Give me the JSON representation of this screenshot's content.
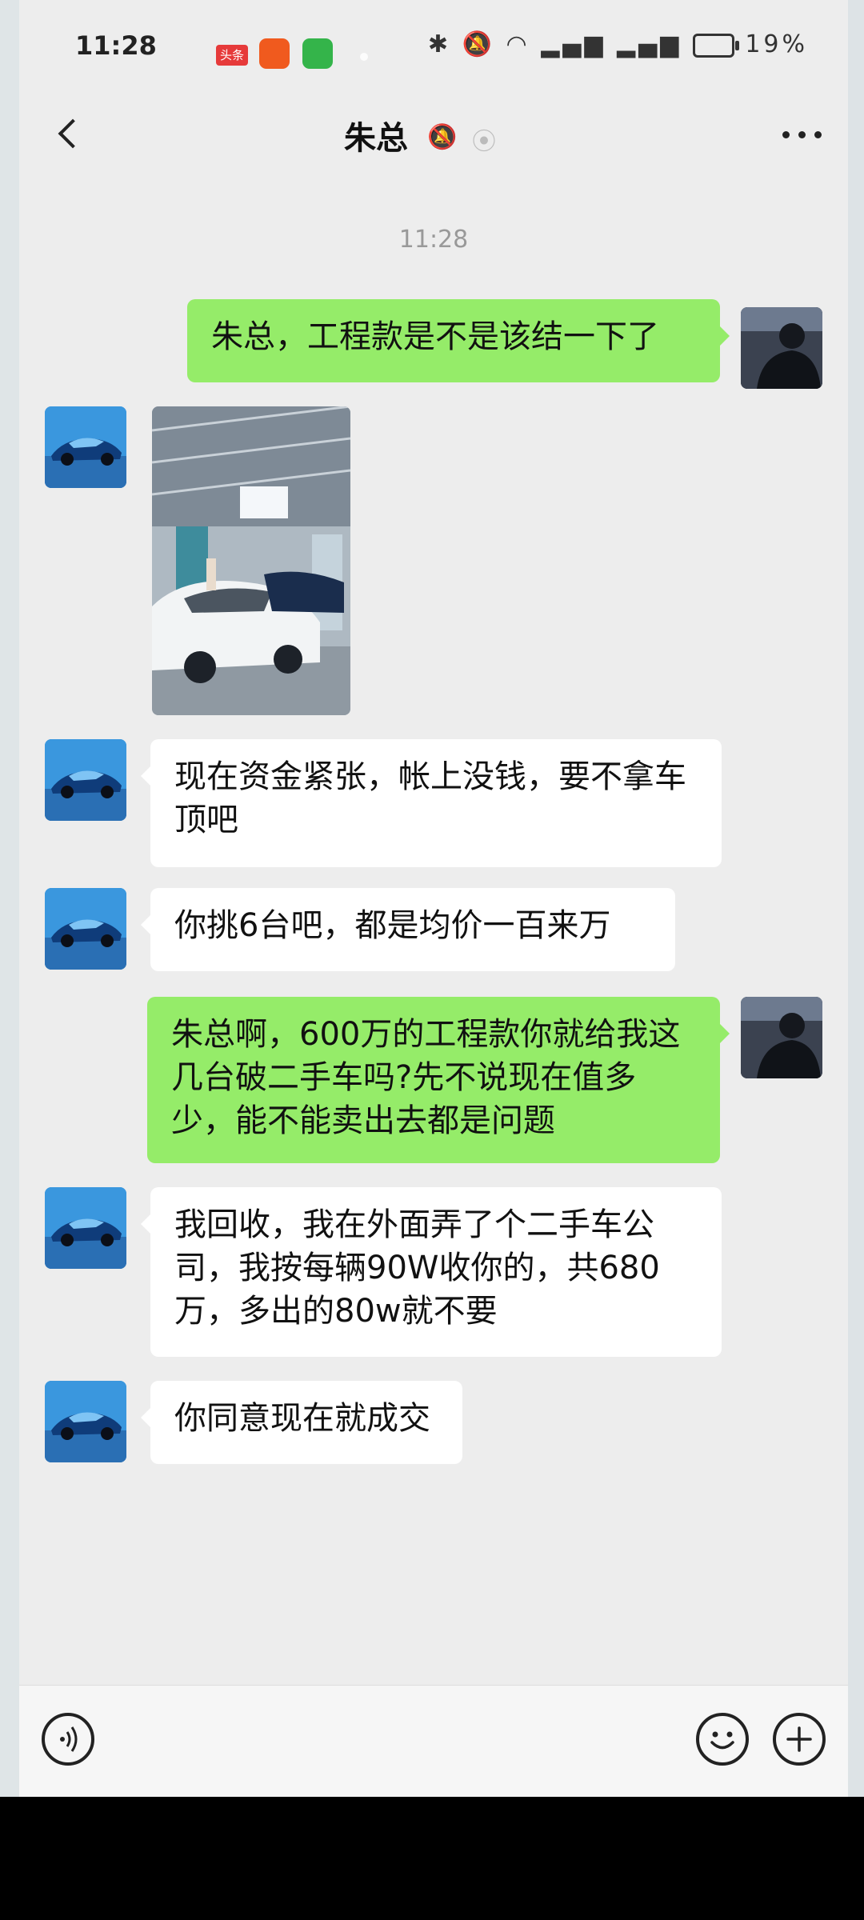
{
  "status_bar": {
    "time": "11:28",
    "toutiao_badge": "头条",
    "battery": "19%"
  },
  "header": {
    "title": "朱总"
  },
  "chat": {
    "timestamp": "11:28",
    "messages": [
      {
        "from": "me",
        "type": "text",
        "text": "朱总，工程款是不是该结一下了"
      },
      {
        "from": "contact",
        "type": "image"
      },
      {
        "from": "contact",
        "type": "text",
        "text": "现在资金紧张，帐上没钱，要不拿车顶吧"
      },
      {
        "from": "contact",
        "type": "text",
        "text": "你挑6台吧，都是均价一百来万"
      },
      {
        "from": "me",
        "type": "text",
        "text": "朱总啊，600万的工程款你就给我这几台破二手车吗?先不说现在值多少，能不能卖出去都是问题"
      },
      {
        "from": "contact",
        "type": "text",
        "text": "我回收，我在外面弄了个二手车公司，我按每辆90W收你的，共680万，多出的80w就不要"
      },
      {
        "from": "contact",
        "type": "text",
        "text": "你同意现在就成交"
      }
    ]
  },
  "colors": {
    "outgoing_bubble": "#95ec69",
    "incoming_bubble": "#ffffff",
    "chat_background": "#ededed"
  },
  "icons": {
    "back": "chevron-left-icon",
    "mute": "bell-off-icon",
    "earpiece": "ear-icon",
    "more": "more-dots-icon",
    "voice": "voice-icon",
    "emoji": "emoji-icon",
    "plus": "plus-icon"
  }
}
